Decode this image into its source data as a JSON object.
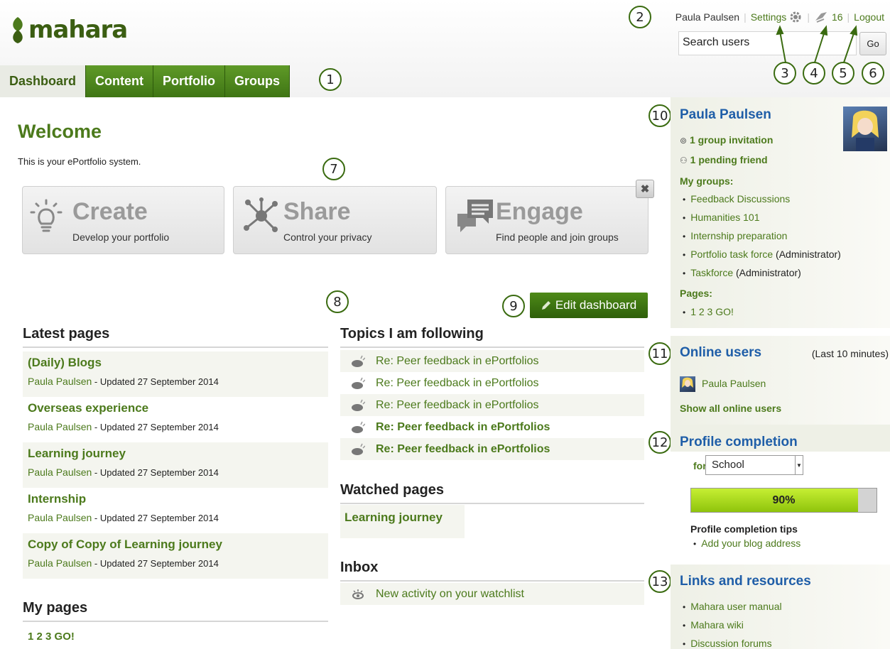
{
  "header": {
    "logo": "mahara",
    "user_name": "Paula Paulsen",
    "settings_label": "Settings",
    "inbox_count": "16",
    "logout_label": "Logout",
    "search_value": "Search users",
    "go_label": "Go"
  },
  "nav": [
    "Dashboard",
    "Content",
    "Portfolio",
    "Groups"
  ],
  "callouts": [
    "1",
    "2",
    "3",
    "4",
    "5",
    "6",
    "7",
    "8",
    "9",
    "10",
    "11",
    "12",
    "13"
  ],
  "main": {
    "welcome": "Welcome",
    "intro": "This is your ePortfolio system.",
    "cards": [
      {
        "title": "Create",
        "sub": "Develop your portfolio"
      },
      {
        "title": "Share",
        "sub": "Control your privacy"
      },
      {
        "title": "Engage",
        "sub": "Find people and join groups"
      }
    ],
    "edit_dashboard": "Edit dashboard",
    "latest_pages": {
      "title": "Latest pages",
      "items": [
        {
          "title": "(Daily) Blogs",
          "author": "Paula Paulsen",
          "meta": " - Updated 27 September 2014"
        },
        {
          "title": "Overseas experience",
          "author": "Paula Paulsen",
          "meta": " - Updated 27 September 2014"
        },
        {
          "title": "Learning journey",
          "author": "Paula Paulsen",
          "meta": " - Updated 27 September 2014"
        },
        {
          "title": "Internship",
          "author": "Paula Paulsen",
          "meta": " - Updated 27 September 2014"
        },
        {
          "title": "Copy of Copy of Learning journey",
          "author": "Paula Paulsen",
          "meta": " - Updated 27 September 2014"
        }
      ]
    },
    "my_pages": {
      "title": "My pages",
      "items": [
        "1 2 3 GO!"
      ]
    },
    "topics": {
      "title": "Topics I am following",
      "items": [
        "Re: Peer feedback in ePortfolios",
        "Re: Peer feedback in ePortfolios",
        "Re: Peer feedback in ePortfolios",
        "Re: Peer feedback in ePortfolios",
        "Re: Peer feedback in ePortfolios"
      ]
    },
    "watched": {
      "title": "Watched pages",
      "items": [
        "Learning journey"
      ]
    },
    "inbox": {
      "title": "Inbox",
      "items": [
        "New activity on your watchlist"
      ]
    }
  },
  "sidebar": {
    "profile": {
      "name": "Paula Paulsen",
      "invitation": "1 group invitation",
      "pending": "1 pending friend",
      "groups_label": "My groups:",
      "groups": [
        {
          "name": "Feedback Discussions",
          "role": ""
        },
        {
          "name": "Humanities 101",
          "role": ""
        },
        {
          "name": "Internship preparation",
          "role": ""
        },
        {
          "name": "Portfolio task force",
          "role": " (Administrator)"
        },
        {
          "name": "Taskforce",
          "role": " (Administrator)"
        }
      ],
      "pages_label": "Pages:",
      "pages": [
        "1 2 3 GO!"
      ]
    },
    "online": {
      "title": "Online users",
      "note": "(Last 10 minutes)",
      "user": "Paula Paulsen",
      "show_all": "Show all online users"
    },
    "completion": {
      "title": "Profile completion",
      "for_label": "for",
      "selected": "School",
      "percent_value": 0.9,
      "percent_label": "90%",
      "tips_label": "Profile completion tips",
      "tip": "Add your blog address"
    },
    "links": {
      "title": "Links and resources",
      "items": [
        "Mahara user manual",
        "Mahara wiki",
        "Discussion forums"
      ]
    }
  },
  "colors": {
    "accent_green": "#4c7a1c",
    "sidebar_blue": "#1f5ea8"
  }
}
